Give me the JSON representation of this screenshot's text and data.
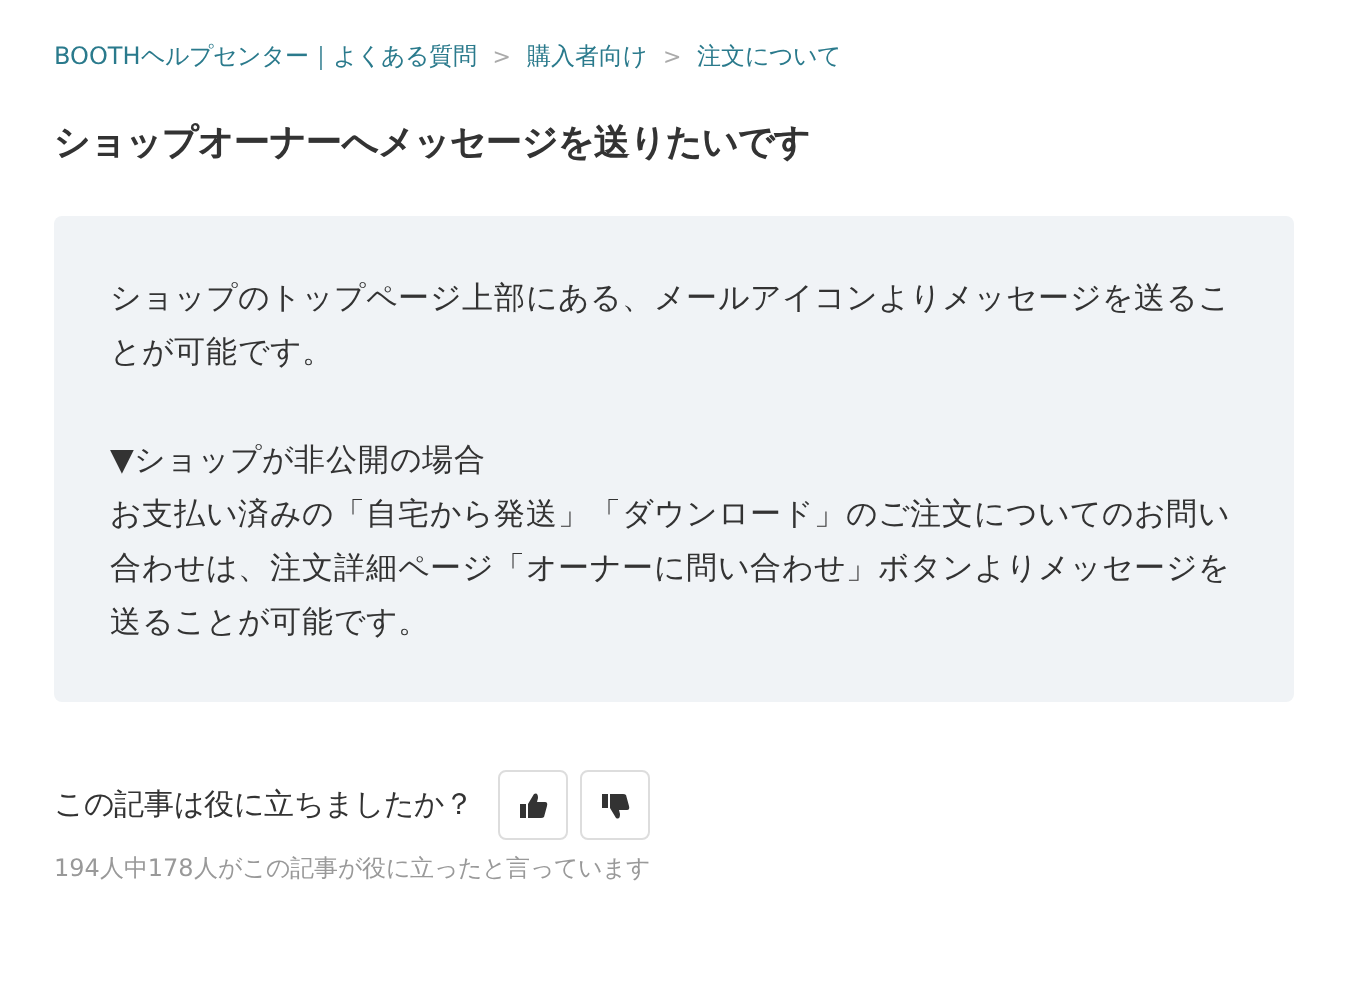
{
  "breadcrumb": {
    "items": [
      "BOOTHヘルプセンター｜よくある質問",
      "購入者向け",
      "注文について"
    ],
    "separator": ">"
  },
  "title": "ショップオーナーへメッセージを送りたいです",
  "body": [
    {
      "lines": [
        "ショップのトップページ上部にある、メールアイコンよりメッセージを送ることが可能です。"
      ]
    },
    {
      "lines": [
        "▼ショップが非公開の場合",
        "お支払い済みの「自宅から発送」「ダウンロード」のご注文についてのお問い合わせは、注文詳細ページ「オーナーに問い合わせ」ボタンよりメッセージを送ることが可能です。"
      ]
    }
  ],
  "feedback": {
    "question": "この記事は役に立ちましたか？",
    "stats": "194人中178人がこの記事が役に立ったと言っています"
  }
}
